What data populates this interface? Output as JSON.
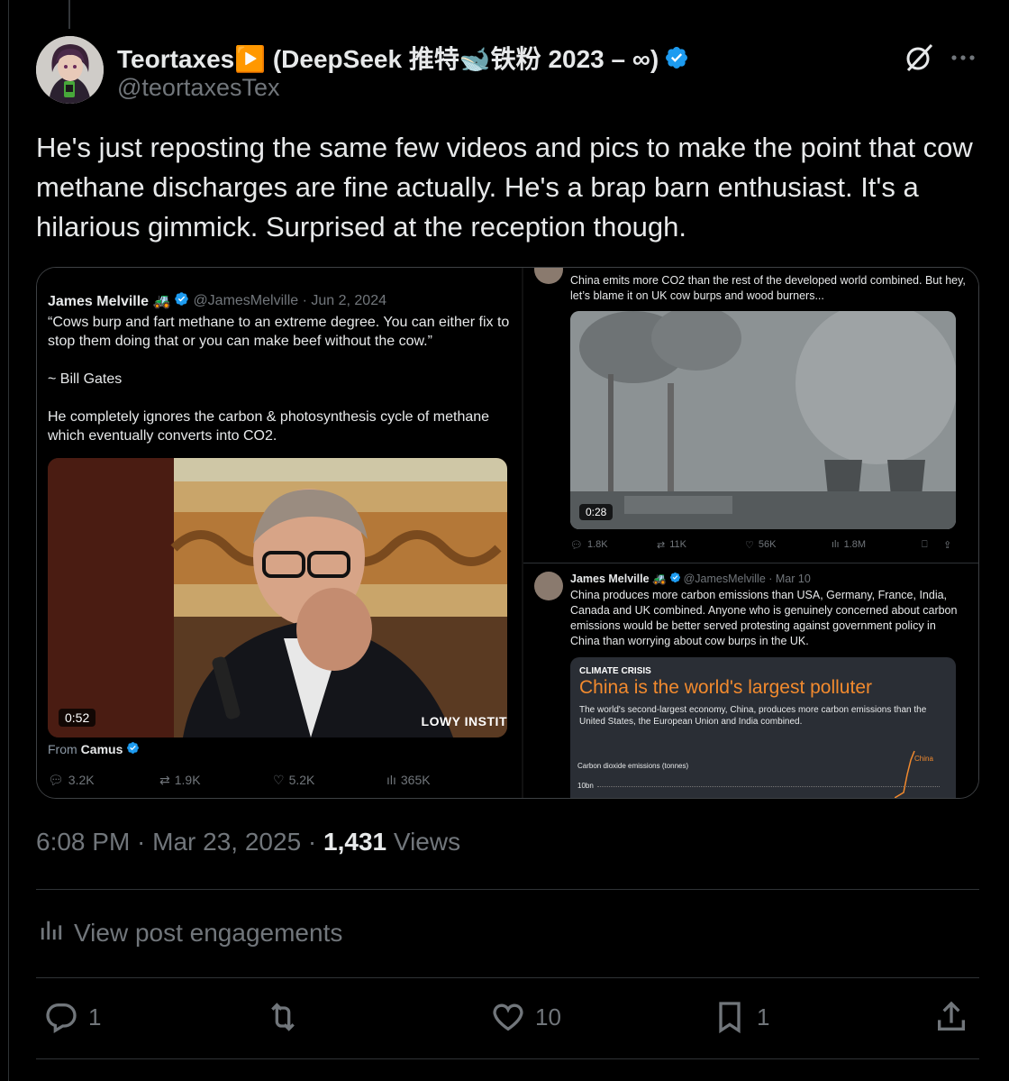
{
  "author": {
    "name": "Teortaxes▶️ (DeepSeek 推特🐋铁粉 2023 – ∞)",
    "handle": "@teortaxesTex"
  },
  "tweet_text": "He's just reposting the same few videos and pics to make the point that cow methane discharges are fine actually. He's a brap barn enthusiast. It's a hilarious gimmick. Surprised at the reception though.",
  "media": {
    "left": {
      "quoted_name": "James Melville 🚜",
      "quoted_handle_date": "@JamesMelville · Jun 2, 2024",
      "quoted_text": "“Cows burp and fart methane to an extreme degree. You can either fix to stop them doing that or you can make beef without the cow.”\n\n~ Bill Gates\n\nHe completely ignores the carbon & photosynthesis cycle of methane which eventually converts into CO2.",
      "video_duration": "0:52",
      "video_watermark": "LOWY INSTIT",
      "from_label": "From",
      "from_name": "Camus",
      "stats": {
        "replies": "3.2K",
        "reposts": "1.9K",
        "likes": "5.2K",
        "views": "365K"
      }
    },
    "right_top": {
      "text": "China emits more CO2 than the rest of the developed world combined. But hey, let’s blame it on UK cow burps and wood burners...",
      "video_duration": "0:28",
      "stats": {
        "replies": "1.8K",
        "reposts": "11K",
        "likes": "56K",
        "views": "1.8M"
      }
    },
    "right_bottom": {
      "name": "James Melville 🚜",
      "handle_date": "@JamesMelville · Mar 10",
      "text": "China produces more carbon emissions than USA, Germany, France, India, Canada and UK combined. Anyone who is genuinely concerned about carbon emissions would be better served protesting against government policy in China than worrying about cow burps in the UK.",
      "card": {
        "kicker": "CLIMATE CRISIS",
        "headline": "China is the world's largest polluter",
        "sub": "The world's second-largest economy, China, produces more carbon emissions than the United States, the European Union and India combined.",
        "chart_label": "Carbon dioxide emissions (tonnes)",
        "tick": "10bn",
        "series_label": "China"
      }
    }
  },
  "meta": {
    "time": "6:08 PM · Mar 23, 2025 · ",
    "views_count": "1,431",
    "views_label": " Views"
  },
  "engagements_label": "View post engagements",
  "actions": {
    "replies": "1",
    "likes": "10",
    "bookmarks": "1"
  },
  "colors": {
    "verified": "#1d9bf0",
    "muted": "#71767b",
    "background": "#000000",
    "accent_orange": "#f28a2e"
  },
  "icons": [
    "verified-badge-icon",
    "grok-icon",
    "more-icon",
    "reply-icon",
    "repost-icon",
    "like-icon",
    "views-icon",
    "bookmark-icon",
    "share-icon",
    "analytics-icon"
  ]
}
